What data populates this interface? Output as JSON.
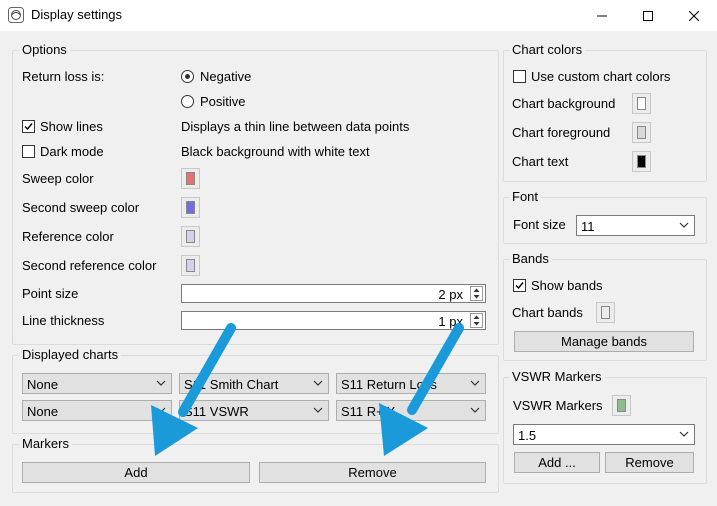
{
  "window": {
    "title": "Display settings"
  },
  "options": {
    "title": "Options",
    "return_loss_label": "Return loss is:",
    "radio_negative": "Negative",
    "radio_positive": "Positive",
    "show_lines_label": "Show lines",
    "show_lines_desc": "Displays a thin line between data points",
    "dark_mode_label": "Dark mode",
    "dark_mode_desc": "Black background with white text",
    "sweep_color_label": "Sweep color",
    "second_sweep_color_label": "Second sweep color",
    "reference_color_label": "Reference color",
    "second_reference_color_label": "Second reference color",
    "point_size_label": "Point size",
    "point_size_value": "2 px",
    "line_thickness_label": "Line thickness",
    "line_thickness_value": "1 px",
    "colors": {
      "sweep": "#e8716f",
      "second_sweep": "#6d6de8",
      "reference": "#d2d2ec",
      "second_reference": "#d2d2ec"
    }
  },
  "displayed_charts": {
    "title": "Displayed charts",
    "row1": [
      "None",
      "S11 Smith Chart",
      "S11 Return Loss"
    ],
    "row2": [
      "None",
      "S11 VSWR",
      "S11 R+jX"
    ]
  },
  "markers": {
    "title": "Markers",
    "add_label": "Add",
    "remove_label": "Remove"
  },
  "chart_colors": {
    "title": "Chart colors",
    "use_custom_label": "Use custom chart colors",
    "background_label": "Chart background",
    "foreground_label": "Chart foreground",
    "text_label": "Chart text",
    "colors": {
      "background": "#ffffff",
      "foreground": "#d9d9d9",
      "text": "#000000"
    }
  },
  "font": {
    "title": "Font",
    "size_label": "Font size",
    "size_value": "11"
  },
  "bands": {
    "title": "Bands",
    "show_bands_label": "Show bands",
    "chart_bands_label": "Chart bands",
    "manage_label": "Manage bands",
    "chart_bands_color": "#ececec"
  },
  "vswr_markers": {
    "title": "VSWR Markers",
    "label": "VSWR Markers",
    "value": "1.5",
    "add_label": "Add ...",
    "remove_label": "Remove",
    "color": "#8fbc8f"
  },
  "annotation_color": "#1a9ad9"
}
